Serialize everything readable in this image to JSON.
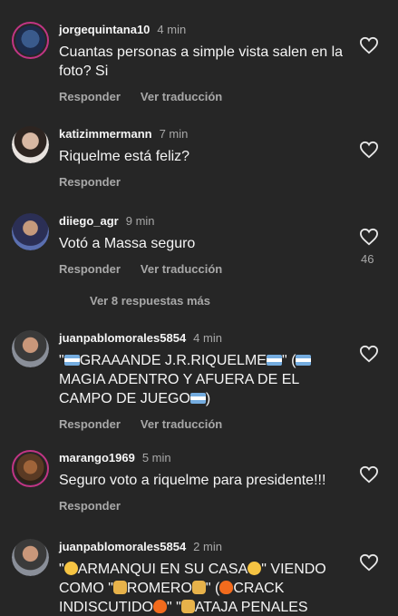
{
  "comments": [
    {
      "username": "jorgequintana10",
      "time": "4 min",
      "text": "Cuantas personas a simple vista salen en la foto? Si",
      "reply_label": "Responder",
      "translate_label": "Ver traducción"
    },
    {
      "username": "katizimmermann",
      "time": "7 min",
      "text": "Riquelme está feliz?",
      "reply_label": "Responder"
    },
    {
      "username": "diiego_agr",
      "time": "9 min",
      "text": "Votó a Massa seguro",
      "reply_label": "Responder",
      "translate_label": "Ver traducción",
      "likes": "46"
    },
    {
      "username": "juanpablomorales5854",
      "time": "4 min",
      "text_parts": [
        "\"",
        "GRAAANDE J.R.RIQUELME",
        "\" (",
        "MAGIA ADENTRO Y AFUERA DE EL CAMPO DE JUEGO",
        ")"
      ],
      "reply_label": "Responder",
      "translate_label": "Ver traducción"
    },
    {
      "username": "marango1969",
      "time": "5 min",
      "text": "Seguro voto a riquelme para presidente!!!",
      "reply_label": "Responder"
    },
    {
      "username": "juanpablomorales5854",
      "time": "2 min",
      "text_parts": [
        "\"",
        "ARMANQUI EN SU CASA",
        "\" VIENDO COMO \"",
        "ROMERO",
        "\" (",
        "CRACK INDISCUTIDO",
        "\" \"",
        "ATAJA PENALES POR"
      ]
    }
  ],
  "more_replies": "Ver 8 respuestas más",
  "colors": {
    "background": "#262626",
    "text": "#f5f5f5",
    "secondary": "#a8a8a8",
    "story_ring": "#c13584"
  },
  "icons": {
    "like": "heart-outline-icon",
    "flag": "argentina-flag-emoji",
    "laugh": "laughing-emoji",
    "fire": "fire-emoji",
    "raised_hands": "raised-hands-emoji"
  }
}
